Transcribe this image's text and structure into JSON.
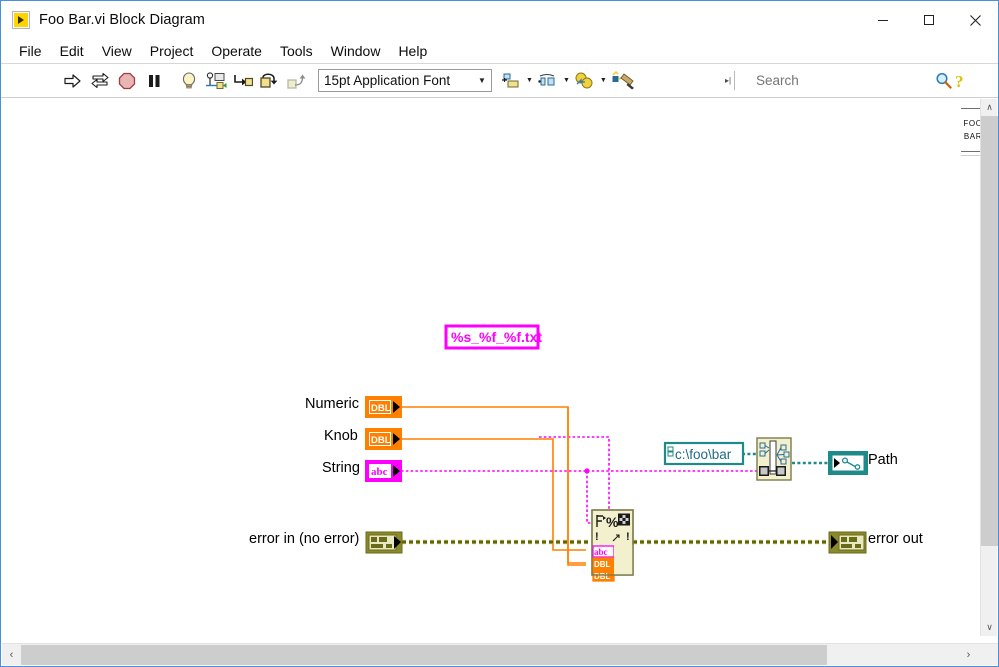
{
  "window": {
    "title": "Foo Bar.vi Block Diagram",
    "icon": "labview-vi-icon",
    "minimize": "—",
    "maximize": "☐",
    "close": "✕"
  },
  "menubar": {
    "items": [
      {
        "label": "File"
      },
      {
        "label": "Edit"
      },
      {
        "label": "View"
      },
      {
        "label": "Project"
      },
      {
        "label": "Operate"
      },
      {
        "label": "Tools"
      },
      {
        "label": "Window"
      },
      {
        "label": "Help"
      }
    ]
  },
  "toolbar": {
    "run_icon": "run-arrow-icon",
    "run_continuous_icon": "run-continuously-icon",
    "abort_icon": "abort-execution-icon",
    "pause_icon": "pause-icon",
    "highlight_icon": "highlight-execution-lightbulb-icon",
    "retain_wire_icon": "retain-wire-values-icon",
    "step_into_icon": "step-into-icon",
    "step_over_icon": "step-over-icon",
    "step_out_icon": "step-out-icon",
    "font_selector": "15pt Application Font",
    "align_icon": "align-objects-icon",
    "distribute_icon": "distribute-objects-icon",
    "reorder_icon": "reorder-objects-icon",
    "cleanup_icon": "cleanup-diagram-icon",
    "dropdown_arrow": "▼",
    "search_placeholder": "Search",
    "search_value": "",
    "search_icon": "magnifier-icon",
    "help_icon": "question-mark-help-icon",
    "resize_handle_icon": "toolbar-overflow-handle-icon",
    "foobar_button": {
      "line1": "FOO",
      "line2": "BAR"
    }
  },
  "diagram": {
    "labels": {
      "numeric": "Numeric",
      "knob": "Knob",
      "string": "String",
      "error_in": "error in (no error)",
      "path": "Path",
      "error_out": "error out"
    },
    "constants": {
      "format_string": "%s_%f_%f.txt",
      "base_path": "c:\\foo\\bar"
    },
    "terminals": {
      "numeric_type": "DBL",
      "knob_type": "DBL",
      "string_type": "abc",
      "error_in_type": "error-cluster",
      "path_type": "path",
      "error_out_type": "error-cluster"
    },
    "nodes": {
      "format_into_string": "Format Into String",
      "build_path": "Build Path"
    },
    "colors": {
      "numeric_wire": "#ff8000",
      "string_wire": "#ff00ff",
      "error_wire": "#8a8a2b",
      "path_wire": "#1f8a8a",
      "node_body": "#f2f0cd",
      "node_border": "#8a8a5a"
    }
  },
  "scrollbars": {
    "vertical_up": "∧",
    "vertical_down": "∨",
    "horizontal_left": "‹",
    "horizontal_right": "›",
    "grip": "⁙"
  }
}
